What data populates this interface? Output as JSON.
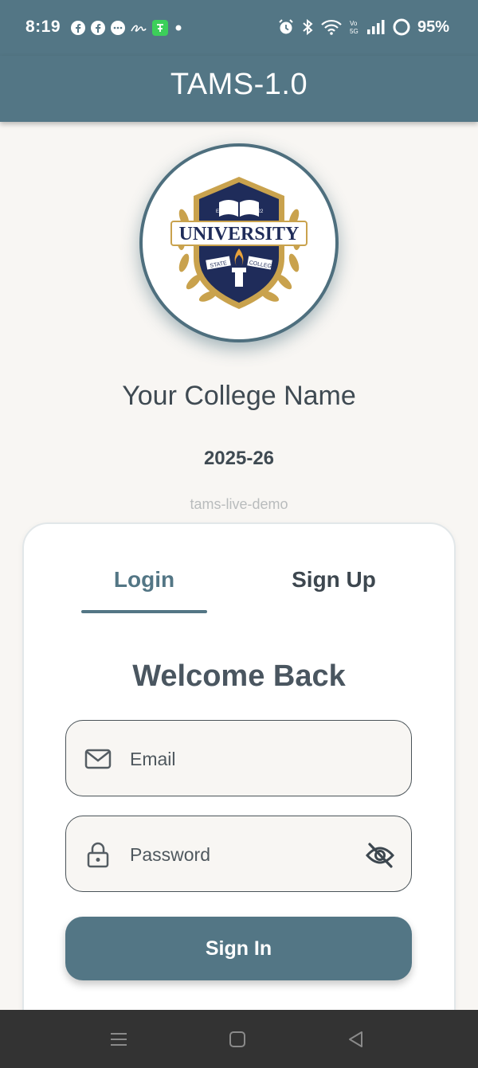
{
  "status_bar": {
    "time": "8:19",
    "battery": "95%",
    "left_icons": [
      "facebook-icon",
      "facebook-icon",
      "messenger-icon",
      "signature-icon",
      "app-notification-icon",
      "dot-icon"
    ],
    "right_icons": [
      "alarm-icon",
      "bluetooth-icon",
      "wifi-icon",
      "volte-icon",
      "signal-icon",
      "battery-ring-icon"
    ]
  },
  "app_bar": {
    "title": "TAMS-1.0"
  },
  "logo": {
    "word": "UNIVERSITY",
    "estd": "ESTD.",
    "year": "2022",
    "ribbon_left": "STATE",
    "ribbon_right": "COLLEGE"
  },
  "college": {
    "name": "Your College Name",
    "year": "2025-26",
    "tenant": "tams-live-demo"
  },
  "auth": {
    "tabs": [
      {
        "label": "Login",
        "active": true
      },
      {
        "label": "Sign Up",
        "active": false
      }
    ],
    "heading": "Welcome Back",
    "email": {
      "placeholder": "Email",
      "value": ""
    },
    "password": {
      "placeholder": "Password",
      "value": ""
    },
    "submit_label": "Sign In"
  },
  "nav_bar": {
    "icons": [
      "recents-icon",
      "home-icon",
      "back-icon"
    ]
  },
  "colors": {
    "primary": "#537685",
    "background": "#f8f6f3",
    "text": "#3f4a52",
    "muted": "#b9bcbd",
    "navy": "#1f2c5a",
    "gold": "#c9a24d"
  }
}
